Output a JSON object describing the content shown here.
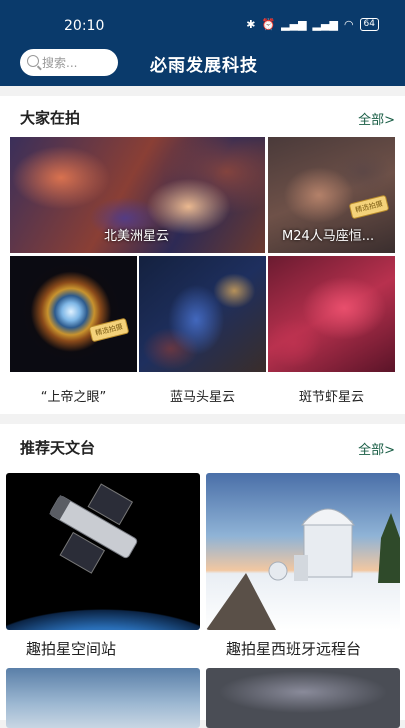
{
  "status": {
    "time": "20:10",
    "battery": "64"
  },
  "header": {
    "search_placeholder": "搜索...",
    "title": "必雨发展科技"
  },
  "gallery": {
    "title": "大家在拍",
    "more": "全部>",
    "items": [
      {
        "name": "北美洲星云"
      },
      {
        "name": "M24人马座恒..."
      },
      {
        "name": "“上帝之眼”"
      },
      {
        "name": "蓝马头星云"
      },
      {
        "name": "斑节虾星云"
      }
    ]
  },
  "observatories": {
    "title": "推荐天文台",
    "more": "全部>",
    "items": [
      {
        "name": "趣拍星空间站"
      },
      {
        "name": "趣拍星西班牙远程台"
      }
    ]
  }
}
